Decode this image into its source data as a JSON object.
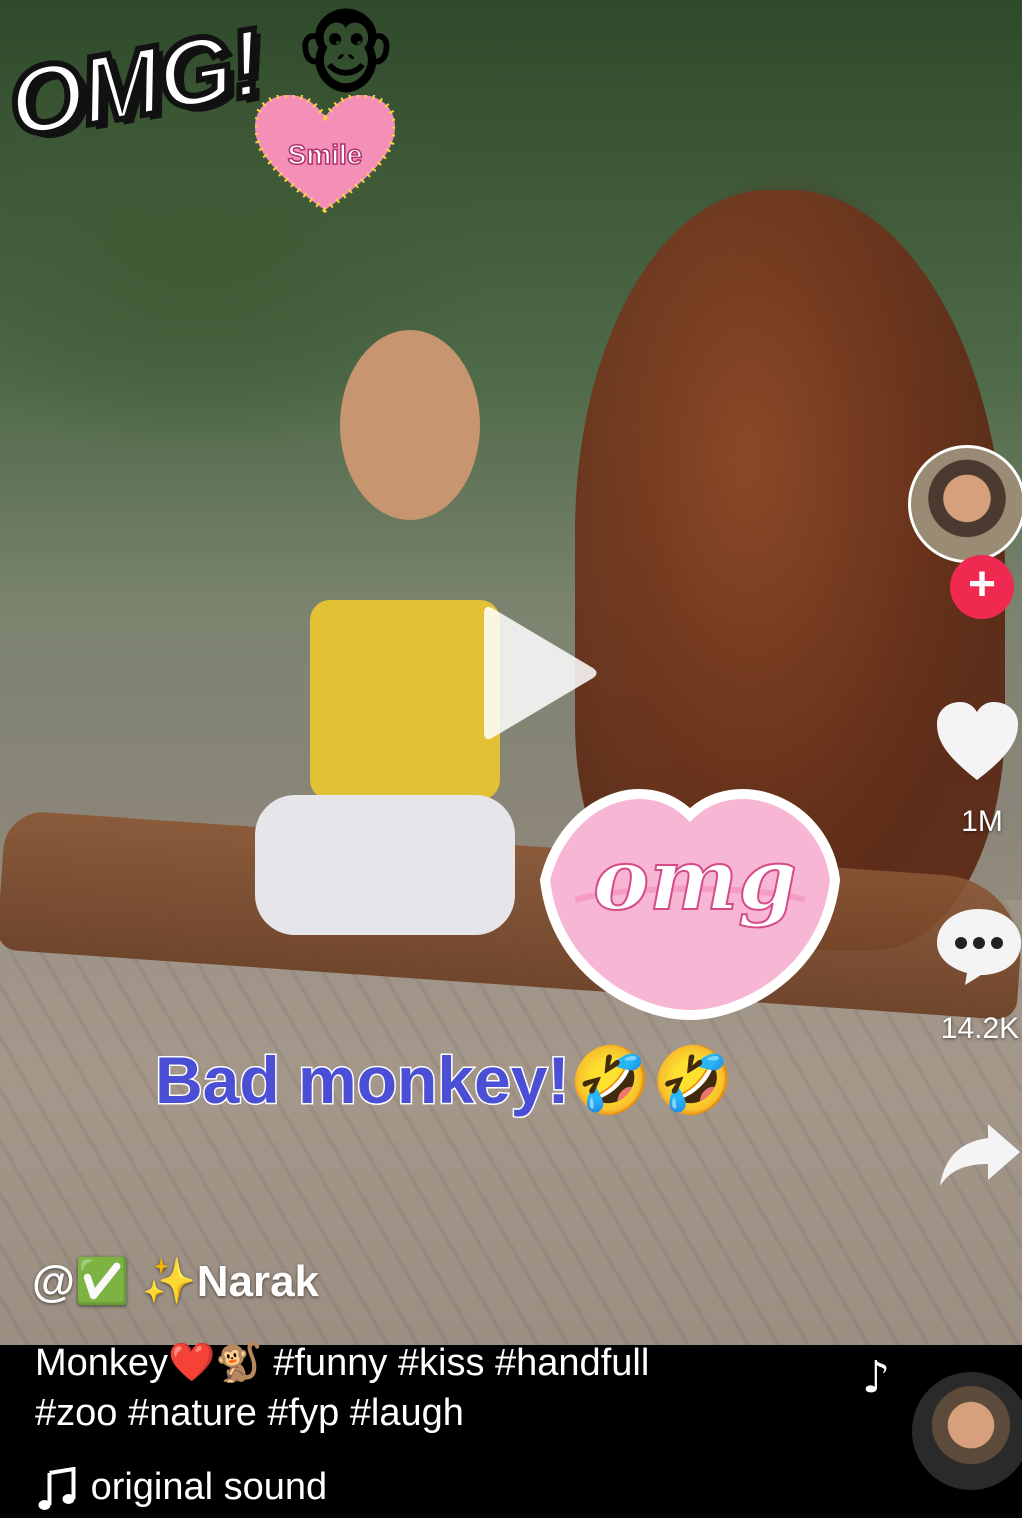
{
  "video": {
    "stickers": {
      "omg_big": "OMG!",
      "smile": "Smile",
      "monkey_emoji": "🐵",
      "lips_word": "omg"
    },
    "caption_overlay": "Bad monkey!🤣🤣"
  },
  "rail": {
    "like_count": "1M",
    "comment_count": "14.2K",
    "follow_symbol": "+"
  },
  "info": {
    "username": "@✅ ✨Narak",
    "description_line1": "Monkey❤️🐒 #funny #kiss #handfull",
    "description_line2": "#zoo #nature #fyp #laugh",
    "sound": "original sound"
  },
  "colors": {
    "accent": "#ef2950",
    "caption_text": "#4a4fd6"
  }
}
